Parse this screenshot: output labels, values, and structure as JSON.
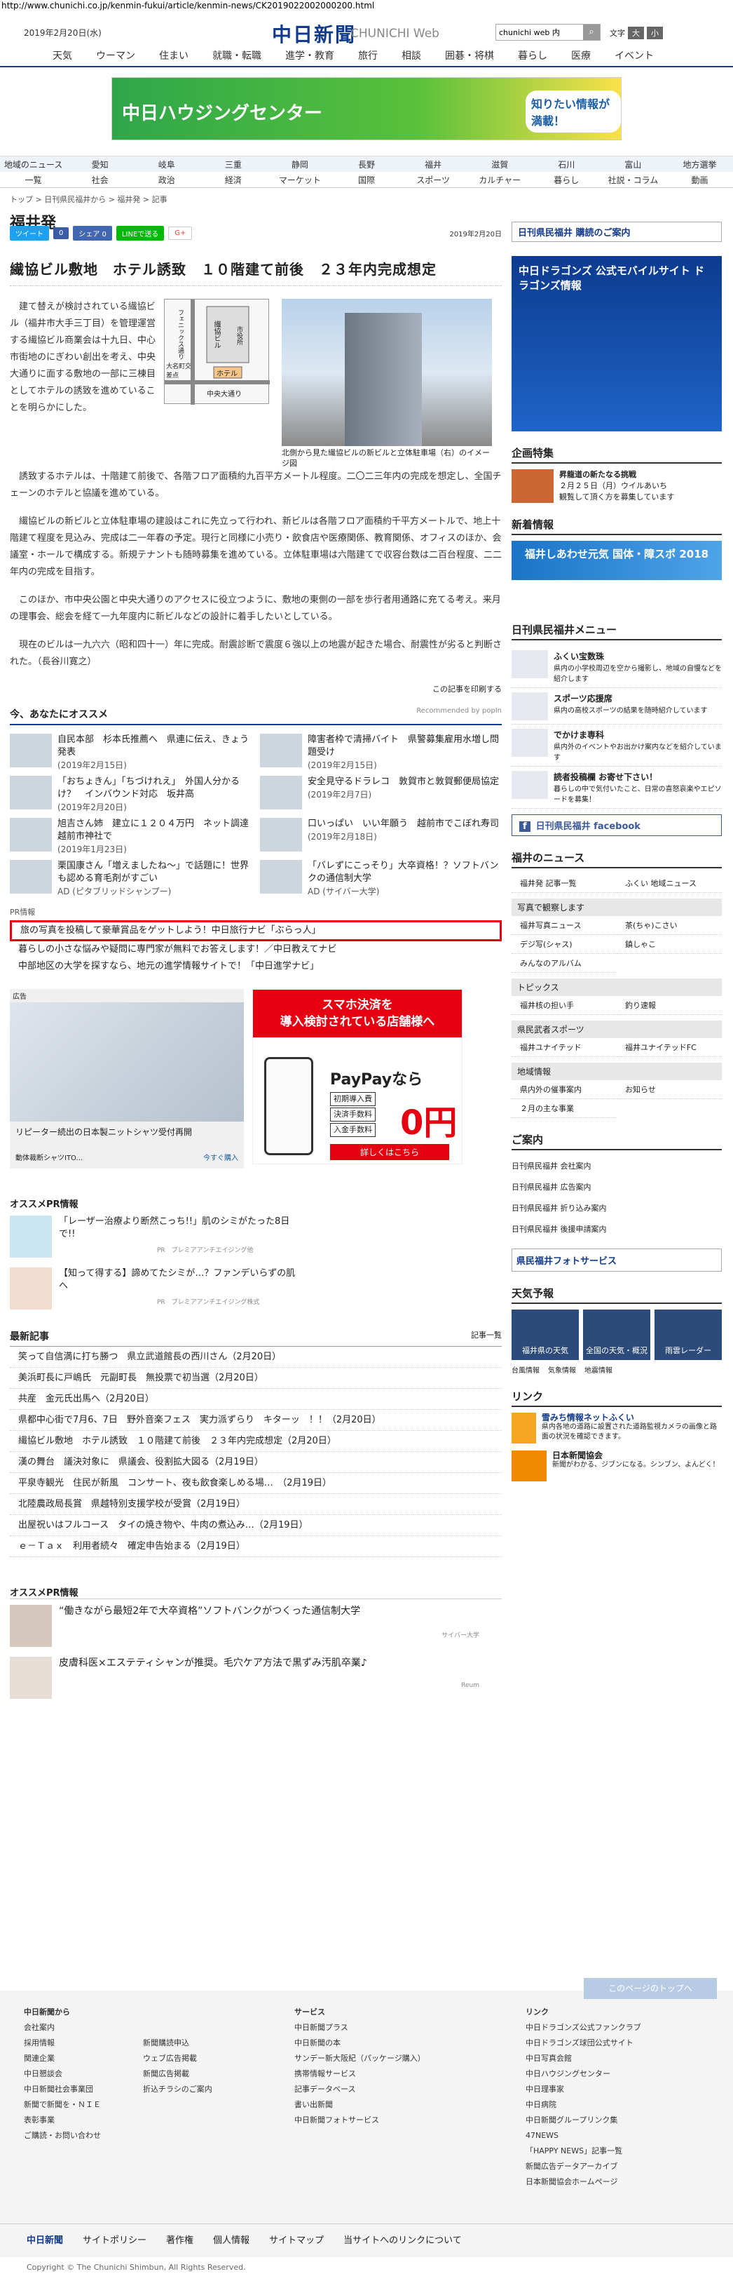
{
  "url": "http://www.chunichi.co.jp/kenmin-fukui/article/kenmin-news/CK2019022002000200.html",
  "header": {
    "date": "2019年2月20日(水)",
    "logo": "中日新聞",
    "logo_en": "CHUNICHI Web",
    "search_value": "chunichi web 内",
    "font_label": "文字",
    "font_small": "小",
    "font_large": "大"
  },
  "gnav": [
    "天気",
    "ウーマン",
    "住まい",
    "就職・転職",
    "進学・教育",
    "旅行",
    "相談",
    "囲碁・将棋",
    "暮らし",
    "医療",
    "イベント"
  ],
  "banner": {
    "title": "中日ハウジングセンター",
    "cta": "知りたい情報が満載！"
  },
  "regnav": {
    "row1": [
      "地域のニュース",
      "愛知",
      "岐阜",
      "三重",
      "静岡",
      "長野",
      "福井",
      "滋賀",
      "石川",
      "富山",
      "地方選挙"
    ],
    "row2": [
      "一覧",
      "社会",
      "政治",
      "経済",
      "マーケット",
      "国際",
      "スポーツ",
      "カルチャー",
      "暮らし",
      "社説・コラム",
      "動画"
    ]
  },
  "crumb": "トップ > 日刊県民福井から > 福井発 > 記事",
  "page_title": "福井発",
  "social": [
    "ツイート",
    "0",
    "シェア 0",
    "LINEで送る",
    "G+"
  ],
  "pubdate": "2019年2月20日",
  "article": {
    "title": "繊協ビル敷地　ホテル誘致　１０階建て前後　２３年内完成想定",
    "lead": "建て替えが検討されている繊協ビル（福井市大手三丁目）を管理運営する繊協ビル商業会は十九日、中心市街地のにぎわい創出を考え、中央大通りに面する敷地の一部に三棟目としてホテルの誘致を進めていることを明らかにした。",
    "p1": "誘致するホテルは、十階建て前後で、各階フロア面積約九百平方メートル程度。二〇二三年内の完成を想定し、全国チェーンのホテルと協議を進めている。",
    "p2": "繊協ビルの新ビルと立体駐車場の建設はこれに先立って行われ、新ビルは各階フロア面積約千平方メートルで、地上十階建て程度を見込み、完成は二一年春の予定。現行と同様に小売り・飲食店や医療関係、教育関係、オフィスのほか、会議室・ホールで構成する。新規テナントも随時募集を進めている。立体駐車場は六階建てで収容台数は二百台程度、二二年内の完成を目指す。",
    "p3": "このほか、市中央公園と中央大通りのアクセスに役立つように、敷地の東側の一部を歩行者用通路に充てる考え。来月の理事会、総会を経て一九年度内に新ビルなどの設計に着手したいとしている。",
    "p4": "現在のビルは一九六六（昭和四十一）年に完成。耐震診断で震度６強以上の地震が起きた場合、耐震性が劣ると判断された。（長谷川寛之）",
    "map_label1": "繊協ビル",
    "map_label2": "フェニックス通り",
    "map_label3": "大名町交差点",
    "map_label4": "ホテル",
    "map_label5": "中央大通り",
    "map_label6": "市役所",
    "caption": "北側から見た繊協ビルの新ビルと立体駐車場（右）のイメージ図",
    "print": "この記事を印刷する"
  },
  "recommend": {
    "heading": "今、あなたにオススメ",
    "powered": "Recommended by popIn",
    "items": [
      {
        "t": "自民本部　杉本氏推薦へ　県連に伝え、きょう発表",
        "d": "(2019年2月15日)"
      },
      {
        "t": "障害者枠で清掃バイト　県警募集雇用水増し問題受け",
        "d": "(2019年2月15日)"
      },
      {
        "t": "「おちょきん」「ちづけれえ」　外国人分かるけ？　インバウンド対応　坂井高",
        "d": "(2019年2月20日)"
      },
      {
        "t": "安全見守るドラレコ　敦賀市と敦賀郵便局協定",
        "d": "(2019年2月7日)"
      },
      {
        "t": "旭吉さん姉　建立に１２０４万円　ネット調達　越前市神社で",
        "d": "(2019年1月23日)"
      },
      {
        "t": "口いっぱい　いい年願う　越前市でこぼれ寿司",
        "d": "(2019年2月18日)"
      },
      {
        "t": "栗国康さん「増えましたね～」で話題に！世界も認める育毛剤がすごい",
        "d": "AD (ピタブリッドシャンプー)"
      },
      {
        "t": "「バレずにこっそり」大卒資格！？ソフトバンクの通信制大学",
        "d": "AD (サイバー大学)"
      }
    ]
  },
  "pr": {
    "heading": "PR情報",
    "items": [
      "旅の写真を投稿して豪華賞品をゲットしよう！中日旅行ナビ「ぶらっ人」",
      "暮らしの小さな悩みや疑問に専門家が無料でお答えします！／中日教えてナビ",
      "中部地区の大学を探すなら、地元の進学情報サイトで！「中日進学ナビ」"
    ]
  },
  "ads": {
    "left_label": "広告",
    "left_title": "リピーター続出の日本製ニットシャツ受付再開",
    "left_small": "動体裁断シャツITO...",
    "left_cta": "今すぐ購入",
    "right_t1": "スマホ決済を",
    "right_t2": "導入検討されている店舗様へ",
    "right_brand": "PayPayなら",
    "right_f1": "初期導入費",
    "right_f2": "決済手数料",
    "right_f3": "入金手数料",
    "right_zero": "0円",
    "right_cta": "詳しくはこちら"
  },
  "osusume_pr": {
    "heading": "オススメPR情報",
    "items": [
      {
        "t": "「レーザー治療より断然こっち!!」肌のシミがたった8日で!!",
        "s": "PR　プレミアアンチエイジング他"
      },
      {
        "t": "【知って得する】諦めてたシミが…？ファンデいらずの肌へ",
        "s": "PR　プレミアアンチエイジング株式"
      }
    ]
  },
  "latest": {
    "heading": "最新記事",
    "more": "記事一覧",
    "items": [
      "笑って自信満に打ち勝つ　県立武道館長の西川さん（2月20日）",
      "美浜町長に戸嶋氏　元副町長　無投票で初当選（2月20日）",
      "共産　金元氏出馬へ（2月20日）",
      "県都中心街で7月6、7日　野外音楽フェス　実力派ずらり　キターッ　！！（2月20日）",
      "繊協ビル敷地　ホテル誘致　１０階建て前後　２３年内完成想定（2月20日）",
      "漢の舞台　議決対象に　県議会、役割拡大図る（2月19日）",
      "平泉寺観光　住民が新風　コンサート、夜も飲食楽しめる場…　（2月19日）",
      "北陸農政局長賞　県越特別支援学校が受賞（2月19日）",
      "出屋祝いはフルコース　タイの焼き物や、牛肉の煮込み…（2月19日）",
      "ｅ－Ｔａｘ　利用者続々　確定申告始まる（2月19日）"
    ]
  },
  "osusume_pr2": {
    "heading": "オススメPR情報",
    "items": [
      {
        "t": "“働きながら最短2年で大卒資格”ソフトバンクがつくった通信制大学",
        "s": "サイバー大学"
      },
      {
        "t": "皮膚科医×エステティシャンが推奨。毛穴ケア方法で黒ずみ汚肌卒業♪",
        "s": "Reum"
      }
    ]
  },
  "side": {
    "kenmin": "日刊県民福井 購読のご案内",
    "dragons": "中日ドラゴンズ 公式モバイルサイト ドラゴンズ情報",
    "kikaku": "企画特集",
    "kikaku_title": "昇龍道の新たなる挑戦",
    "kikaku_date": "２月２５日（月）ウイルあいち",
    "kikaku_note": "観覧して頂く方を募集しています",
    "shincho": "新着情報",
    "fukui_banner": "福井しあわせ元気 国体・障スポ 2018",
    "menu_h": "日刊県民福井メニュー",
    "menu": [
      {
        "t": "ふくい宝数珠",
        "d": "県内の小学校周辺を空から撮影し、地域の自慢などを紹介します"
      },
      {
        "t": "スポーツ応援席",
        "d": "県内の高校スポーツの結果を随時紹介しています"
      },
      {
        "t": "でかけま専科",
        "d": "県内外のイベントやお出かけ案内などを紹介しています"
      },
      {
        "t": "読者投稿欄 お寄せ下さい！",
        "d": "暮らしの中で気付いたこと、日常の喜怒哀楽やエピソードを募集！"
      }
    ],
    "fb": "日刊県民福井 facebook",
    "fnews_h": "福井のニュース",
    "fnews": [
      "福井発 記事一覧",
      "ふくい 地域ニュース"
    ],
    "shashin": "写真で観察します",
    "shashin_items": [
      "福井写真ニュース",
      "茶(ちゃ)こさい",
      "デジ写(シャス)",
      "鎮しゃこ",
      "みんなのアルバム"
    ],
    "topics": "トピックス",
    "topics_items": [
      "福井核の担い手",
      "釣り速報"
    ],
    "sports": "県民武者スポーツ",
    "sports_items": [
      "福井ユナイテッド",
      "福井ユナイテッドFC"
    ],
    "chiiki": "地域情報",
    "chiiki_items": [
      "県内外の催事案内",
      "お知らせ",
      "２月の主な事業"
    ],
    "annai": "ご案内",
    "annai_items": [
      "日刊県民福井 会社案内",
      "日刊県民福井 広告案内",
      "日刊県民福井 折り込み案内",
      "日刊県民福井 後援申請案内"
    ],
    "photo_service": "県民福井フォトサービス",
    "tenki": "天気予報",
    "tenki_items": [
      "福井県の天気",
      "全国の天気・概況",
      "雨雲レーダー"
    ],
    "tenki_links": [
      "台風情報",
      "気象情報",
      "地震情報"
    ],
    "link": "リンク",
    "link1_t": "雪みち情報ネットふくい",
    "link1_d": "県内各地の道路に設置された道路監視カメラの画像と路面の状況を確認できます。",
    "link2_t": "日本新聞協会",
    "link2_d": "新聞がわかる、ジブンになる。シンブン、よんどく！"
  },
  "totop": "このページのトップへ",
  "footer": {
    "c1_h": "中日新聞から",
    "c1": [
      "会社案内",
      "採用情報",
      "関連企業",
      "中日懇談会",
      "中日新聞社会事業団",
      "新聞で新聞を・ＮＩＥ",
      "表彰事業",
      "ご購読・お問い合わせ"
    ],
    "c2": [
      "新聞購読申込",
      "ウェブ広告掲載",
      "新聞広告掲載",
      "折込チラシのご案内"
    ],
    "c3_h": "サービス",
    "c3": [
      "中日新聞プラス",
      "中日新聞の本",
      "サンデー新大阪紀（パッケージ購入）",
      "携帯情報サービス",
      "記事データベース",
      "書い出新聞",
      "中日新聞フォトサービス"
    ],
    "c4_h": "リンク",
    "c4": [
      "中日ドラゴンズ公式ファンクラブ",
      "中日ドラゴンズ球団公式サイト",
      "中日写真会館",
      "中日ハウジングセンター",
      "中日理事家",
      "中日病院",
      "中日新聞グループリンク集",
      "47NEWS",
      "「HAPPY NEWS」記事一覧",
      "新聞広告データアーカイブ",
      "日本新聞協会ホームページ"
    ],
    "bar": [
      "中日新聞",
      "サイトポリシー",
      "著作権",
      "個人情報",
      "サイトマップ",
      "当サイトへのリンクについて"
    ],
    "copy": "Copyright © The Chunichi Shimbun, All Rights Reserved."
  },
  "colors": {
    "brand": "#123b8c",
    "highlight": "#e60012"
  }
}
